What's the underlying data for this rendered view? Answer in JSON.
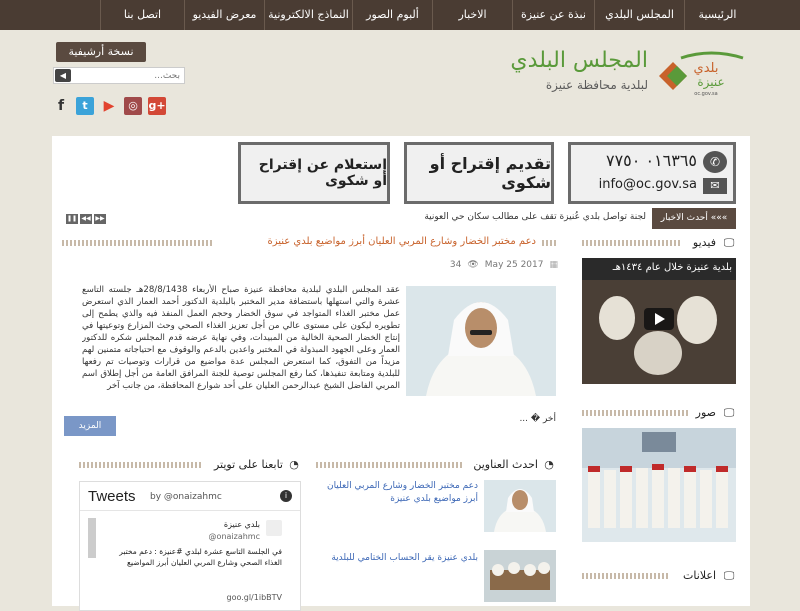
{
  "nav": {
    "items": [
      {
        "label": "الرئيسية",
        "width": 66
      },
      {
        "label": "المجلس البلدي",
        "width": 90
      },
      {
        "label": "نبذة عن عنيزة",
        "width": 82
      },
      {
        "label": "الاخبار",
        "width": 80
      },
      {
        "label": "ألبوم الصور",
        "width": 80
      },
      {
        "label": "النماذج الالكترونية",
        "width": 88
      },
      {
        "label": "معرض الفيديو",
        "width": 80
      },
      {
        "label": "اتصل بنا",
        "width": 84
      }
    ]
  },
  "header": {
    "archive_label": "نسخة أرشيفية",
    "search_placeholder": "بحث...",
    "logo_title": "المجلس البلدي",
    "logo_sub": "لبلدية محافظة عنيزة",
    "logo_mark": "بلدي عنيزة",
    "logo_url": "oc.gov.sa"
  },
  "banners": {
    "suggest": "تقديم إقتراح أو شكوى",
    "inquire": "إستعلام عن إقتراح أو شكوى",
    "phone": "٠١٦٣٦٥ ٧٧٥٠",
    "email": "info@oc.gov.sa"
  },
  "ticker": {
    "label": "»»» أحدث الاخبار",
    "text": "لجنة تواصل بلدي عُنيزة تقف على مطالب سكان حي العونية"
  },
  "article": {
    "title": "دعم مختبر الخضار وشارع المربي العليان أبرز مواضيع بلدي عنيزة",
    "date": "May 25 2017",
    "views": "34",
    "body": "عقد المجلس البلدي لبلدية محافظة عنيزة صباح الأربعاء 28/8/1438هـ جلسته التاسع عشرة والتي استهلها باستضافة مدير المختبر بالبلدية الدكتور أحمد العمار الذي استعرض عمل مختبر الغذاء المتواجد في سوق الخضار وحجم العمل المنفذ فيه والذي يطمح إلى تطويره ليكون على مستوى عالي من أجل تعزيز الغذاء الصحي وحث المزارع وتوعيتها في إنتاج الخضار الصحية الخالية من المبيدات، وفي نهاية عرضه قدم المجلس شكره للدكتور العمار وعلى الجهود المبذولة في المختبر واعدين بالدعم والوقوف مع احتياجاته متمنين لهم مزيداً من التفوق، كما استعرض المجلس عدة مواضيع من قرارات وتوصيات تم رفعها للبلدية ومتابعة تنفيذها، كما رفع المجلس توصية للجنة المرافق العامة من أجل إطلاق اسم المربي الفاضل الشيخ عبدالرحمن العليان على أحد شوارع المحافظة، من جانب آخر",
    "more_text": "أخر � ...",
    "more_button": "المزيد"
  },
  "sections": {
    "video": "فيديو",
    "video_caption": "بلدية عنيزة خلال عام ١٤٣٤هـ",
    "photos": "صور",
    "ads": "اعلانات",
    "latest": "احدث العناوين",
    "twitter": "تابعنا على تويتر"
  },
  "latest_news": [
    {
      "text": "دعم مختبر الخضار وشارع المربي العليان أبرز مواضيع بلدي عنيزة"
    },
    {
      "text": "بلدي عنيزة يقر الحساب الختامي للبلدية"
    }
  ],
  "twitter": {
    "title": "Tweets",
    "handle": "by @onaizahmc",
    "account_name": "بلدي عنيزة",
    "account_handle": "@onaizahmc",
    "tweet": "في الجلسة التاسع عشرة لبلدي #عنيزة : دعم مختبر الغذاء الصحي وشارع المربي العليان أبرز المواضيع",
    "link": "goo.gl/1ibBTV"
  },
  "colors": {
    "nav": "#4a3c33",
    "accent": "#c8622b",
    "link": "#3d68b6",
    "green": "#5a9a3a"
  }
}
